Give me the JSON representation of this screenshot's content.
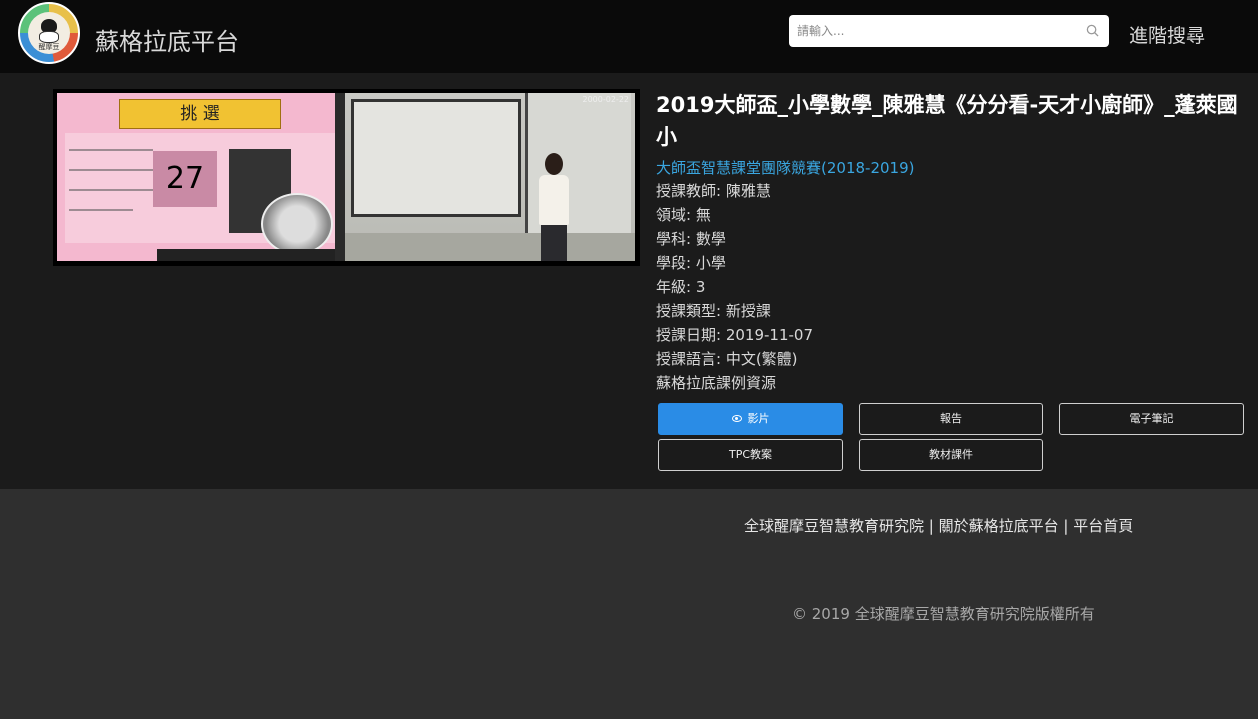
{
  "header": {
    "logo_text": "醒摩豆",
    "site_title": "蘇格拉底平台",
    "search_placeholder": "請輸入...",
    "advanced_search": "進階搜尋"
  },
  "video": {
    "slide_heading": "挑  選",
    "timer_value": "27",
    "timestamp": "2000-02-22"
  },
  "detail": {
    "title": "2019大師盃_小學數學_陳雅慧《分分看-天才小廚師》_蓬萊國小",
    "series": "大師盃智慧課堂團隊競賽(2018-2019)",
    "meta": [
      "授課教師: 陳雅慧",
      "領域: 無",
      "學科: 數學",
      "學段: 小學",
      "年級: 3",
      "授課類型: 新授課",
      "授課日期: 2019-11-07",
      "授課語言: 中文(繁體)",
      "蘇格拉底課例資源"
    ]
  },
  "buttons": {
    "video": "影片",
    "report": "報告",
    "notes": "電子筆記",
    "tpc": "TPC教案",
    "materials": "教材課件"
  },
  "footer": {
    "link1": "全球醒摩豆智慧教育研究院",
    "sep": " | ",
    "link2": "關於蘇格拉底平台",
    "link3": "平台首頁",
    "copyright": "© 2019 全球醒摩豆智慧教育研究院版權所有"
  },
  "colors": {
    "accent": "#2a8ce6",
    "link": "#3aa6e0",
    "header_bg": "#0a0a0a",
    "footer_bg": "#2f2f2f"
  }
}
